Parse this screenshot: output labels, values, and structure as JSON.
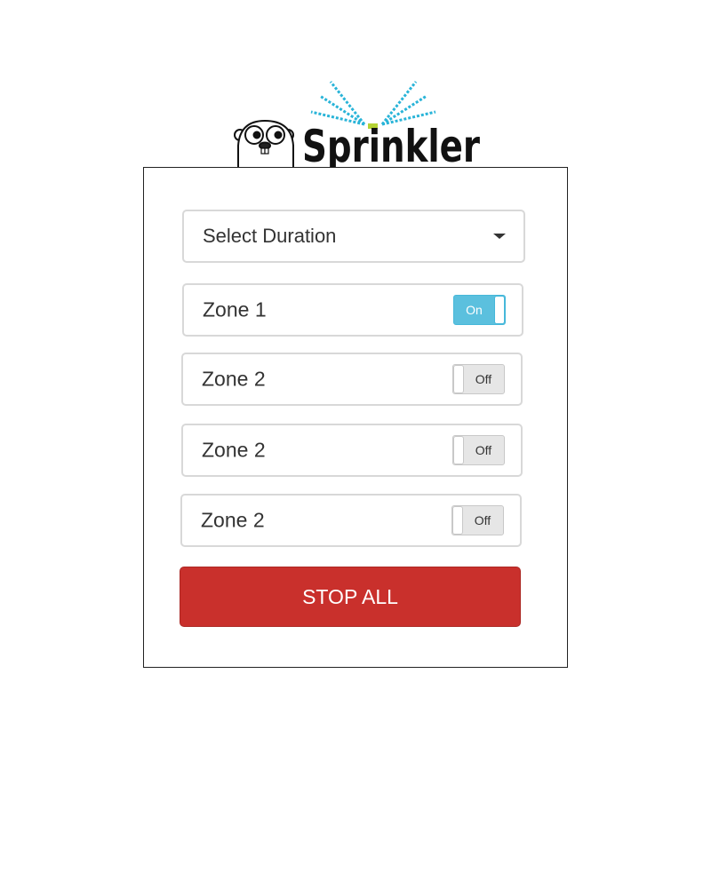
{
  "logo": {
    "text": "Sprinkler"
  },
  "duration_select": {
    "selected": "Select Duration"
  },
  "zones": [
    {
      "label": "Zone 1",
      "state": "On",
      "on": true
    },
    {
      "label": "Zone 2",
      "state": "Off",
      "on": false
    },
    {
      "label": "Zone 2",
      "state": "Off",
      "on": false
    },
    {
      "label": "Zone 2",
      "state": "Off",
      "on": false
    }
  ],
  "stop_button": {
    "label": "STOP ALL"
  },
  "colors": {
    "toggle_on": "#5bc0de",
    "toggle_off": "#e6e6e6",
    "danger": "#c9302c"
  }
}
